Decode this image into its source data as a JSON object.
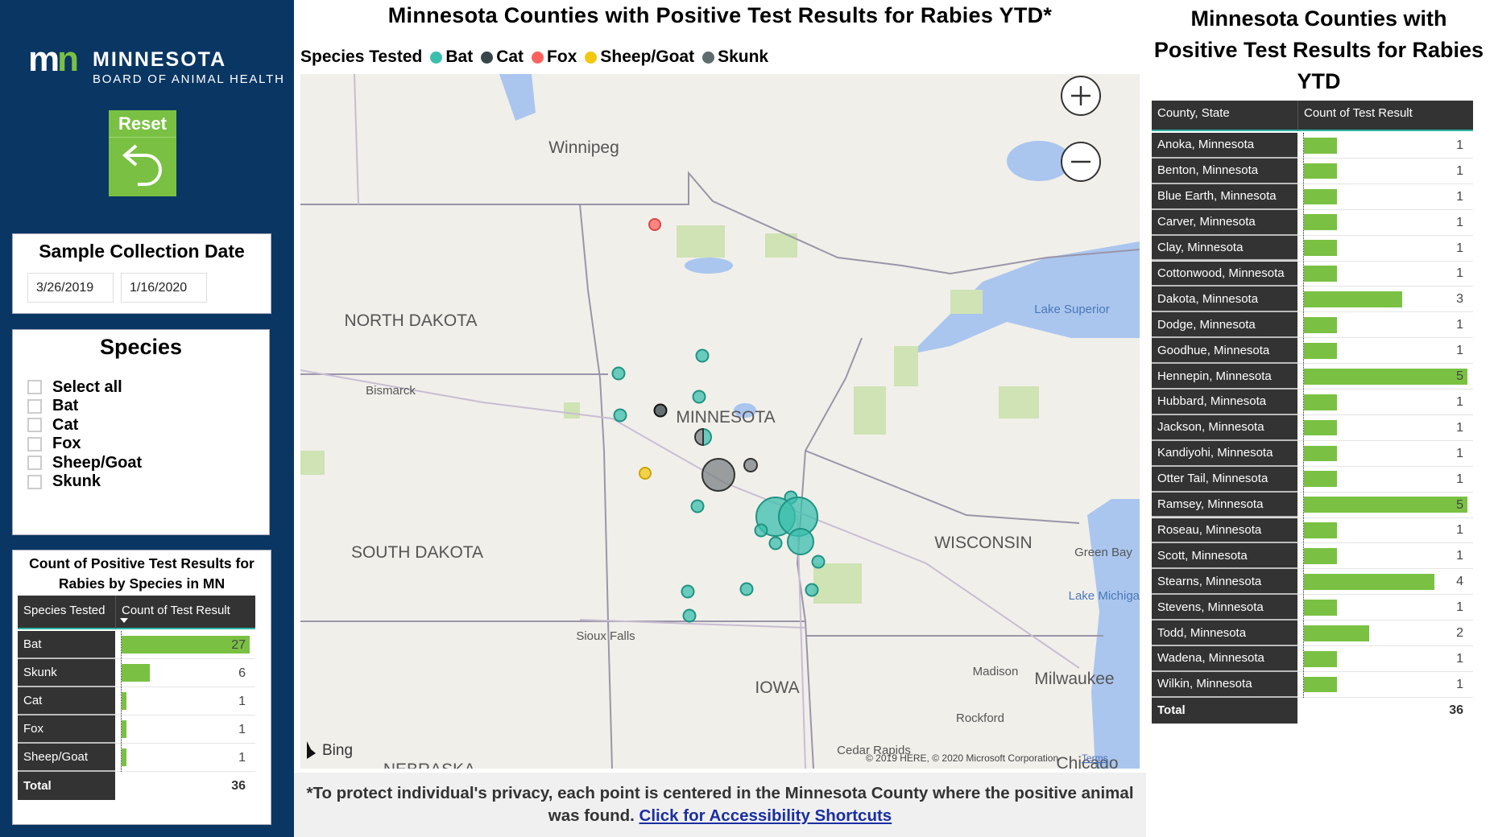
{
  "logo": {
    "mark": "mn",
    "name": "MINNESOTA",
    "subtitle": "BOARD OF ANIMAL HEALTH"
  },
  "reset": {
    "label": "Reset",
    "icon": "undo-arrow-icon"
  },
  "date_filter": {
    "title": "Sample Collection Date",
    "start": "3/26/2019",
    "end": "1/16/2020"
  },
  "species_filter": {
    "title": "Species",
    "options": [
      "Select all",
      "Bat",
      "Cat",
      "Fox",
      "Sheep/Goat",
      "Skunk"
    ]
  },
  "species_table": {
    "title": "Count of Positive Test Results for Rabies by Species in MN",
    "headers": [
      "Species Tested",
      "Count of Test Result"
    ],
    "rows": [
      {
        "name": "Bat",
        "count": 27
      },
      {
        "name": "Skunk",
        "count": 6
      },
      {
        "name": "Cat",
        "count": 1
      },
      {
        "name": "Fox",
        "count": 1
      },
      {
        "name": "Sheep/Goat",
        "count": 1
      }
    ],
    "total_label": "Total",
    "total": 36,
    "sort": "descending"
  },
  "map": {
    "title": "Minnesota Counties with Positive Test Results for Rabies YTD*",
    "legend_title": "Species Tested",
    "legend": [
      {
        "name": "Bat",
        "color": "#3bbfad"
      },
      {
        "name": "Cat",
        "color": "#374649"
      },
      {
        "name": "Fox",
        "color": "#fd625e"
      },
      {
        "name": "Sheep/Goat",
        "color": "#f2c80f"
      },
      {
        "name": "Skunk",
        "color": "#5f6b6d"
      }
    ],
    "labels": {
      "winnipeg": "Winnipeg",
      "nd": "NORTH DAKOTA",
      "bismarck": "Bismarck",
      "mn": "MINNESOTA",
      "sd": "SOUTH DAKOTA",
      "wi": "WISCONSIN",
      "superior": "Lake Superior",
      "greenbay": "Green Bay",
      "siouxfalls": "Sioux Falls",
      "iowa": "IOWA",
      "madison": "Madison",
      "milwaukee": "Milwaukee",
      "rockford": "Rockford",
      "cedar": "Cedar Rapids",
      "ne": "NEBRASKA",
      "chicago": "Chicago",
      "michigan": "Lake Michigan"
    },
    "bing": "Bing",
    "copyright": "© 2019 HERE, © 2020 Microsoft Corporation",
    "terms": "Terms"
  },
  "footer": {
    "text": "*To protect individual's privacy, each point is centered in the Minnesota County where the positive animal was found.",
    "link": "Click for Accessibility Shortcuts"
  },
  "county_table": {
    "title": "Minnesota Counties with Positive Test Results for Rabies YTD",
    "headers": [
      "County, State",
      "Count of Test Result"
    ],
    "rows": [
      {
        "name": "Anoka, Minnesota",
        "count": 1
      },
      {
        "name": "Benton, Minnesota",
        "count": 1
      },
      {
        "name": "Blue Earth, Minnesota",
        "count": 1
      },
      {
        "name": "Carver, Minnesota",
        "count": 1
      },
      {
        "name": "Clay, Minnesota",
        "count": 1
      },
      {
        "name": "Cottonwood, Minnesota",
        "count": 1
      },
      {
        "name": "Dakota, Minnesota",
        "count": 3
      },
      {
        "name": "Dodge, Minnesota",
        "count": 1
      },
      {
        "name": "Goodhue, Minnesota",
        "count": 1
      },
      {
        "name": "Hennepin, Minnesota",
        "count": 5
      },
      {
        "name": "Hubbard, Minnesota",
        "count": 1
      },
      {
        "name": "Jackson, Minnesota",
        "count": 1
      },
      {
        "name": "Kandiyohi, Minnesota",
        "count": 1
      },
      {
        "name": "Otter Tail, Minnesota",
        "count": 1
      },
      {
        "name": "Ramsey, Minnesota",
        "count": 5
      },
      {
        "name": "Roseau, Minnesota",
        "count": 1
      },
      {
        "name": "Scott, Minnesota",
        "count": 1
      },
      {
        "name": "Stearns, Minnesota",
        "count": 4
      },
      {
        "name": "Stevens, Minnesota",
        "count": 1
      },
      {
        "name": "Todd, Minnesota",
        "count": 2
      },
      {
        "name": "Wadena, Minnesota",
        "count": 1
      },
      {
        "name": "Wilkin, Minnesota",
        "count": 1
      }
    ],
    "total_label": "Total",
    "total": 36
  },
  "colors": {
    "sidebar": "#0a3663",
    "bar": "#7ac143",
    "table_header": "#333333",
    "link": "#1a2fa0"
  }
}
